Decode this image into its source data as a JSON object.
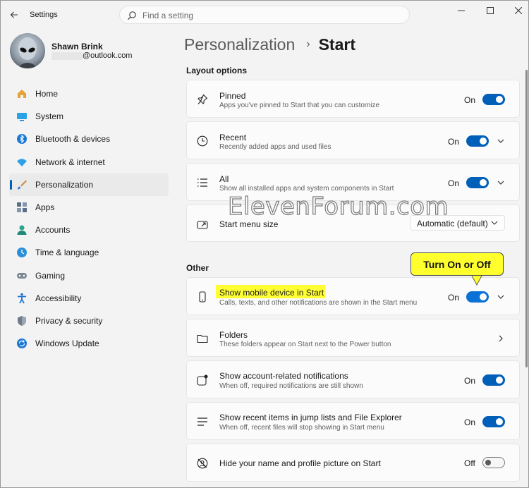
{
  "window": {
    "title": "Settings"
  },
  "search": {
    "placeholder": "Find a setting"
  },
  "user": {
    "name": "Shawn Brink",
    "email": "@outlook.com"
  },
  "sidebar": {
    "items": [
      {
        "label": "Home",
        "icon": "home-icon",
        "color": "#e8a23a"
      },
      {
        "label": "System",
        "icon": "system-icon",
        "color": "#2aa2e6"
      },
      {
        "label": "Bluetooth & devices",
        "icon": "bluetooth-icon",
        "color": "#1b78d6"
      },
      {
        "label": "Network & internet",
        "icon": "wifi-icon",
        "color": "#2da2e8"
      },
      {
        "label": "Personalization",
        "icon": "brush-icon",
        "color": "#d08a45",
        "active": true
      },
      {
        "label": "Apps",
        "icon": "apps-icon",
        "color": "#5a6e88"
      },
      {
        "label": "Accounts",
        "icon": "person-icon",
        "color": "#28a58c"
      },
      {
        "label": "Time & language",
        "icon": "globe-clock-icon",
        "color": "#2b8fd8"
      },
      {
        "label": "Gaming",
        "icon": "gamepad-icon",
        "color": "#7b8794"
      },
      {
        "label": "Accessibility",
        "icon": "accessibility-icon",
        "color": "#1f73d0"
      },
      {
        "label": "Privacy & security",
        "icon": "shield-icon",
        "color": "#6f7b87"
      },
      {
        "label": "Windows Update",
        "icon": "update-icon",
        "color": "#1b78d6"
      }
    ]
  },
  "breadcrumb": {
    "parent": "Personalization",
    "separator": "›",
    "current": "Start"
  },
  "sections": {
    "layout": "Layout options",
    "other": "Other"
  },
  "settings": {
    "pinned": {
      "title": "Pinned",
      "subtitle": "Apps you've pinned to Start that you can customize",
      "state": "On",
      "enabled": true
    },
    "recent": {
      "title": "Recent",
      "subtitle": "Recently added apps and used files",
      "state": "On",
      "enabled": true
    },
    "all": {
      "title": "All",
      "subtitle": "Show all installed apps and system components in Start",
      "state": "On",
      "enabled": true
    },
    "menu_size": {
      "title": "Start menu size",
      "value": "Automatic (default)"
    },
    "mobile": {
      "title": "Show mobile device in Start",
      "subtitle": "Calls, texts, and other notifications are shown in the Start menu",
      "state": "On",
      "enabled": true
    },
    "folders": {
      "title": "Folders",
      "subtitle": "These folders appear on Start next to the Power button"
    },
    "account_notifications": {
      "title": "Show account-related notifications",
      "subtitle": "When off, required notifications are still shown",
      "state": "On",
      "enabled": true
    },
    "recent_items": {
      "title": "Show recent items in jump lists and File Explorer",
      "subtitle": "When off, recent files will stop showing in Start menu",
      "state": "On",
      "enabled": true
    },
    "hide_name": {
      "title": "Hide your name and profile picture on Start",
      "state": "Off",
      "enabled": false
    }
  },
  "annotation": {
    "callout": "Turn On or Off"
  },
  "watermark": "ElevenForum.com",
  "colors": {
    "accent": "#005fb8",
    "highlight": "#ffff33"
  }
}
